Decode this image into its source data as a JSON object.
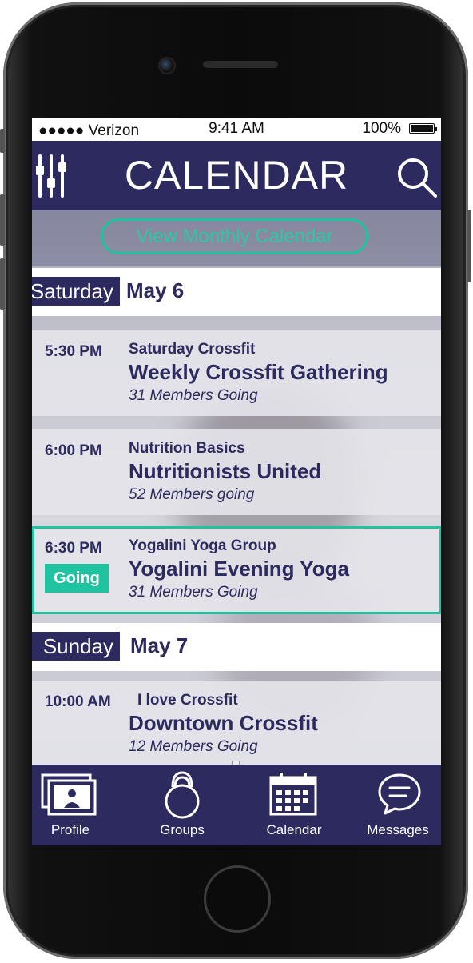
{
  "status_bar": {
    "carrier": "●●●●● Verizon",
    "time": "9:41 AM",
    "battery": "100%"
  },
  "header": {
    "title": "CALENDAR",
    "left_icon": "filter-sliders-icon",
    "right_icon": "search-icon"
  },
  "monthly_button": {
    "label": "View Monthly Calendar"
  },
  "days": [
    {
      "weekday": "Saturday",
      "date": "May 6",
      "events": [
        {
          "time": "5:30 PM",
          "group": "Saturday Crossfit",
          "title": "Weekly Crossfit Gathering",
          "members": "31 Members Going",
          "going": false
        },
        {
          "time": "6:00 PM",
          "group": "Nutrition Basics",
          "title": "Nutritionists United",
          "members": "52 Members going",
          "going": false
        },
        {
          "time": "6:30 PM",
          "group": "Yogalini Yoga Group",
          "title": "Yogalini Evening Yoga",
          "members": "31 Members Going",
          "going": true,
          "going_label": "Going"
        }
      ]
    },
    {
      "weekday": "Sunday",
      "date": "May 7",
      "events": [
        {
          "time": "10:00 AM",
          "group": "I love Crossfit",
          "title": "Downtown Crossfit",
          "members": "12 Members Going",
          "going": false
        }
      ]
    }
  ],
  "tabbar": [
    {
      "label": "Profile",
      "icon": "profile-card-icon"
    },
    {
      "label": "Groups",
      "icon": "kettlebell-icon"
    },
    {
      "label": "Calendar",
      "icon": "calendar-icon"
    },
    {
      "label": "Messages",
      "icon": "chat-bubble-icon"
    }
  ],
  "colors": {
    "navy": "#2c2a5e",
    "accent": "#1fc3a0"
  }
}
